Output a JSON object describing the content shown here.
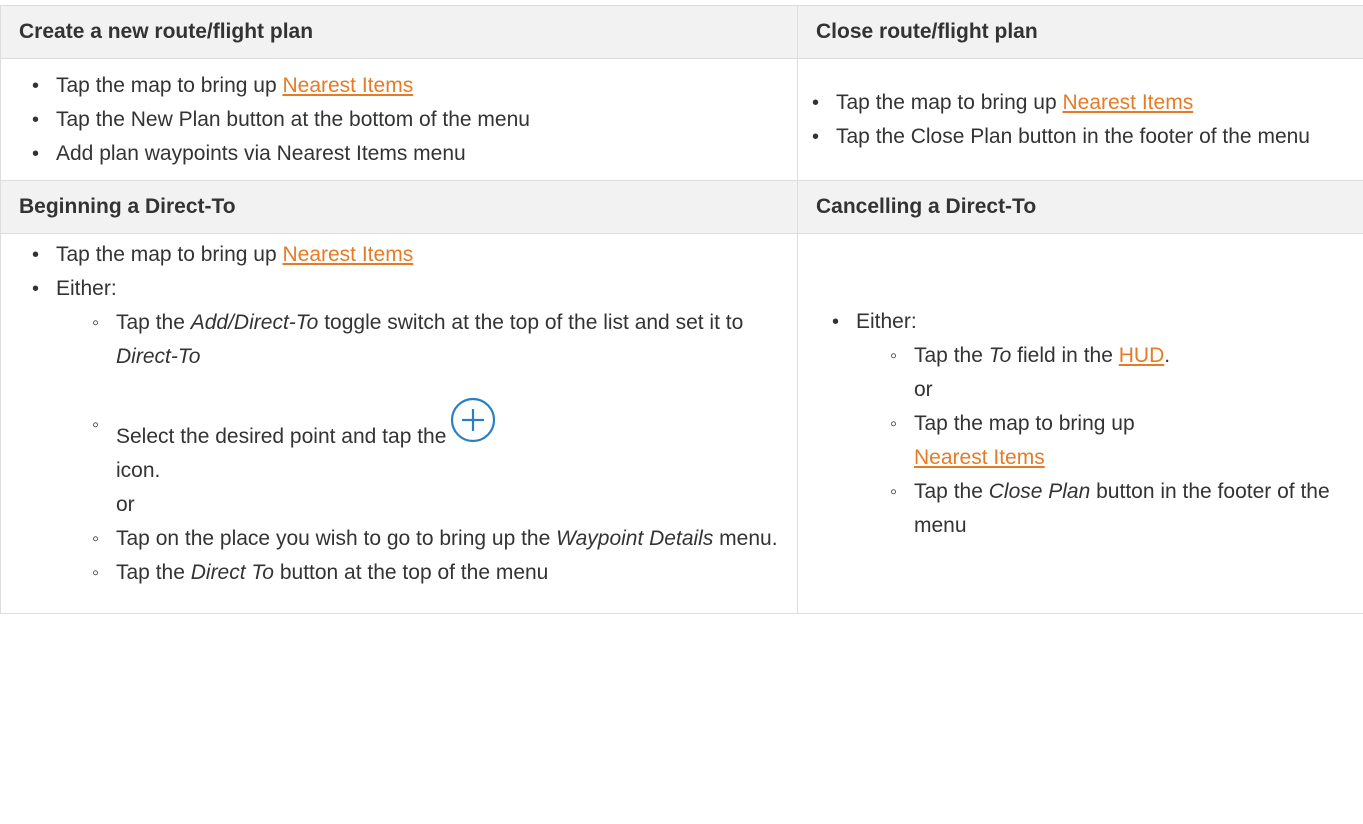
{
  "headers": {
    "create_plan": "Create a new route/flight plan",
    "close_plan": "Close route/flight plan",
    "begin_direct": "Beginning a Direct-To",
    "cancel_direct": "Cancelling a Direct-To"
  },
  "create": {
    "item1_pre": "Tap the map to bring up ",
    "item1_link": "Nearest Items",
    "item2": "Tap the New Plan button at the bottom of the menu",
    "item3": "Add plan waypoints via Nearest Items menu"
  },
  "close": {
    "item1_pre": "Tap the map to bring up ",
    "item1_link": "Nearest Items",
    "item2": "Tap the Close Plan button in the footer of the menu"
  },
  "begin": {
    "item1_pre": "Tap the map to bring up ",
    "item1_link": "Nearest Items",
    "either": "Either:",
    "sub1_a": "Tap the ",
    "sub1_em1": "Add/Direct-To",
    "sub1_b": " toggle switch at the top of the list and set it to ",
    "sub1_em2": "Direct-To",
    "sub2_a": "Select the desired point and tap the ",
    "sub2_b": "icon.",
    "or": "or",
    "sub3_a": "Tap on the place you wish to go to bring up the ",
    "sub3_em": "Waypoint Details",
    "sub3_b": " menu.",
    "sub4_a": "Tap the ",
    "sub4_em": "Direct To",
    "sub4_b": " button at the top of the menu",
    "icon": "plus-circle-icon"
  },
  "cancel": {
    "either": "Either:",
    "sub1_a": "Tap the ",
    "sub1_em": "To",
    "sub1_b": " field in the ",
    "sub1_link": "HUD",
    "sub1_c": ".",
    "or": "or",
    "sub2_pre": "Tap the map to bring up ",
    "sub2_link": "Nearest Items",
    "sub3_a": "Tap the ",
    "sub3_em": "Close Plan",
    "sub3_b": " button in the footer of the menu"
  },
  "colors": {
    "link": "#e77b25",
    "header_bg": "#f2f2f2",
    "icon": "#2a7fc1"
  }
}
